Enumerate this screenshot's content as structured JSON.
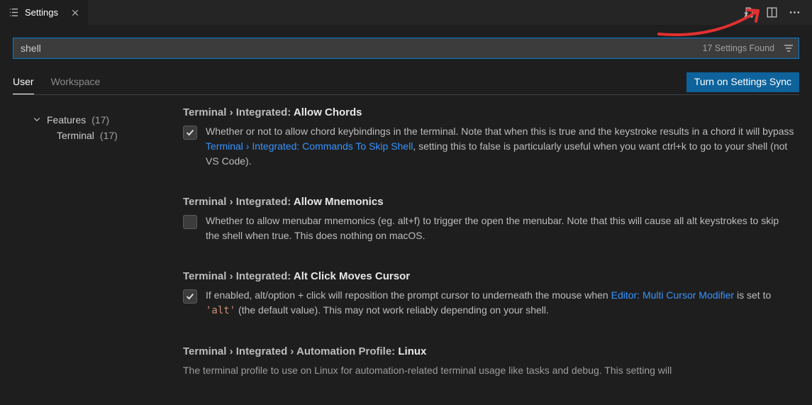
{
  "tab": {
    "title": "Settings"
  },
  "search": {
    "value": "shell",
    "results_label": "17 Settings Found"
  },
  "scopes": {
    "user": "User",
    "workspace": "Workspace"
  },
  "sync_button": "Turn on Settings Sync",
  "tree": {
    "features_label": "Features",
    "features_count": "(17)",
    "terminal_label": "Terminal",
    "terminal_count": "(17)"
  },
  "settings": {
    "s0": {
      "title_prefix": "Terminal › Integrated: ",
      "title_bold": "Allow Chords",
      "desc_a": "Whether or not to allow chord keybindings in the terminal. Note that when this is true and the keystroke results in a chord it will bypass ",
      "link": "Terminal › Integrated: Commands To Skip Shell",
      "desc_b": ", setting this to false is particularly useful when you want ctrl+k to go to your shell (not VS Code)."
    },
    "s1": {
      "title_prefix": "Terminal › Integrated: ",
      "title_bold": "Allow Mnemonics",
      "desc": "Whether to allow menubar mnemonics (eg. alt+f) to trigger the open the menubar. Note that this will cause all alt keystrokes to skip the shell when true. This does nothing on macOS."
    },
    "s2": {
      "title_prefix": "Terminal › Integrated: ",
      "title_bold": "Alt Click Moves Cursor",
      "desc_a": "If enabled, alt/option + click will reposition the prompt cursor to underneath the mouse when ",
      "link": "Editor: Multi Cursor Modifier",
      "desc_b": " is set to ",
      "code": "'alt'",
      "desc_c": " (the default value). This may not work reliably depending on your shell."
    },
    "s3": {
      "title_prefix": "Terminal › Integrated › Automation Profile: ",
      "title_bold": "Linux",
      "desc": "The terminal profile to use on Linux for automation-related terminal usage like tasks and debug. This setting will"
    }
  }
}
